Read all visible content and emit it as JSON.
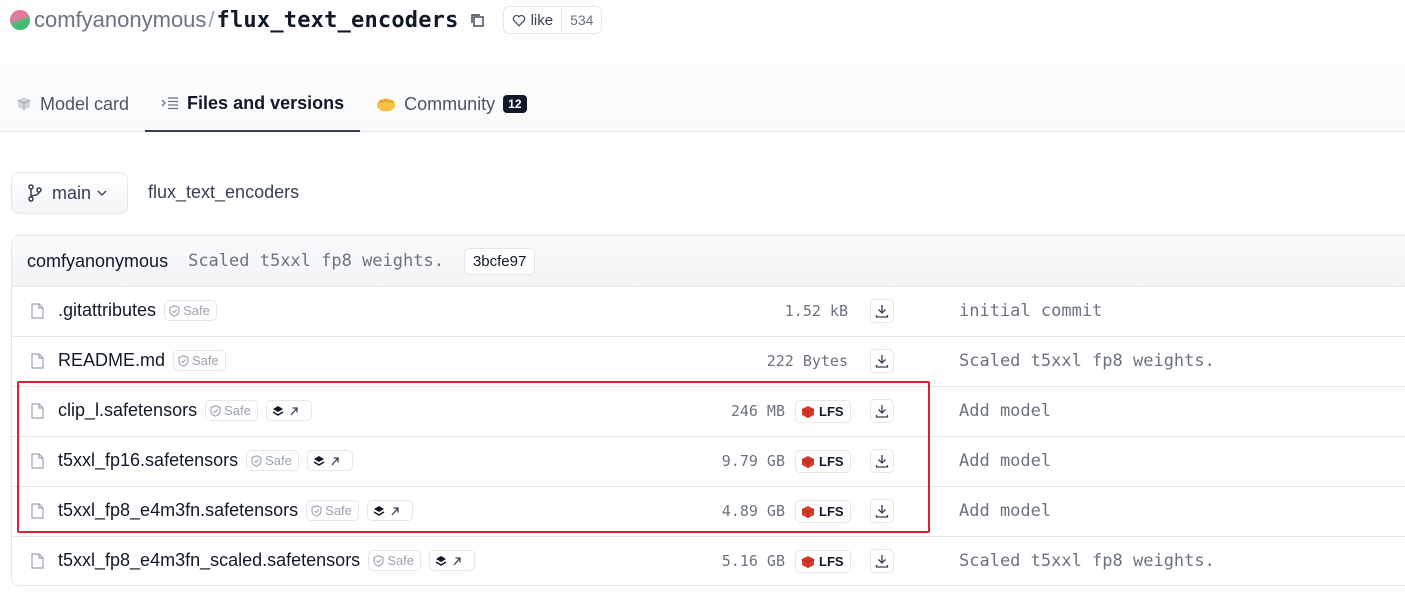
{
  "repo": {
    "owner": "comfyanonymous",
    "separator": "/",
    "name": "flux_text_encoders",
    "like_label": "like",
    "like_count": "534"
  },
  "tabs": [
    {
      "label": "Model card",
      "icon": "cube-icon",
      "active": false
    },
    {
      "label": "Files and versions",
      "icon": "files-icon",
      "active": true
    },
    {
      "label": "Community",
      "icon": "community-icon",
      "count": "12",
      "active": false
    }
  ],
  "branch": {
    "label": "main",
    "path": "flux_text_encoders"
  },
  "commit": {
    "author": "comfyanonymous",
    "message": "Scaled t5xxl fp8 weights.",
    "hash": "3bcfe97"
  },
  "files": [
    {
      "name": ".gitattributes",
      "safe": "Safe",
      "size": "1.52 kB",
      "lfs": false,
      "viewer": false,
      "last_commit": "initial commit"
    },
    {
      "name": "README.md",
      "safe": "Safe",
      "size": "222 Bytes",
      "lfs": false,
      "viewer": false,
      "last_commit": "Scaled t5xxl fp8 weights."
    },
    {
      "name": "clip_l.safetensors",
      "safe": "Safe",
      "size": "246 MB",
      "lfs": true,
      "lfs_label": "LFS",
      "viewer": true,
      "last_commit": "Add model"
    },
    {
      "name": "t5xxl_fp16.safetensors",
      "safe": "Safe",
      "size": "9.79 GB",
      "lfs": true,
      "lfs_label": "LFS",
      "viewer": true,
      "last_commit": "Add model"
    },
    {
      "name": "t5xxl_fp8_e4m3fn.safetensors",
      "safe": "Safe",
      "size": "4.89 GB",
      "lfs": true,
      "lfs_label": "LFS",
      "viewer": true,
      "last_commit": "Add model"
    },
    {
      "name": "t5xxl_fp8_e4m3fn_scaled.safetensors",
      "safe": "Safe",
      "size": "5.16 GB",
      "lfs": true,
      "lfs_label": "LFS",
      "viewer": true,
      "last_commit": "Scaled t5xxl fp8 weights."
    }
  ],
  "colors": {
    "highlight": "#d92332",
    "lfs_icon": "#d93b2b"
  }
}
